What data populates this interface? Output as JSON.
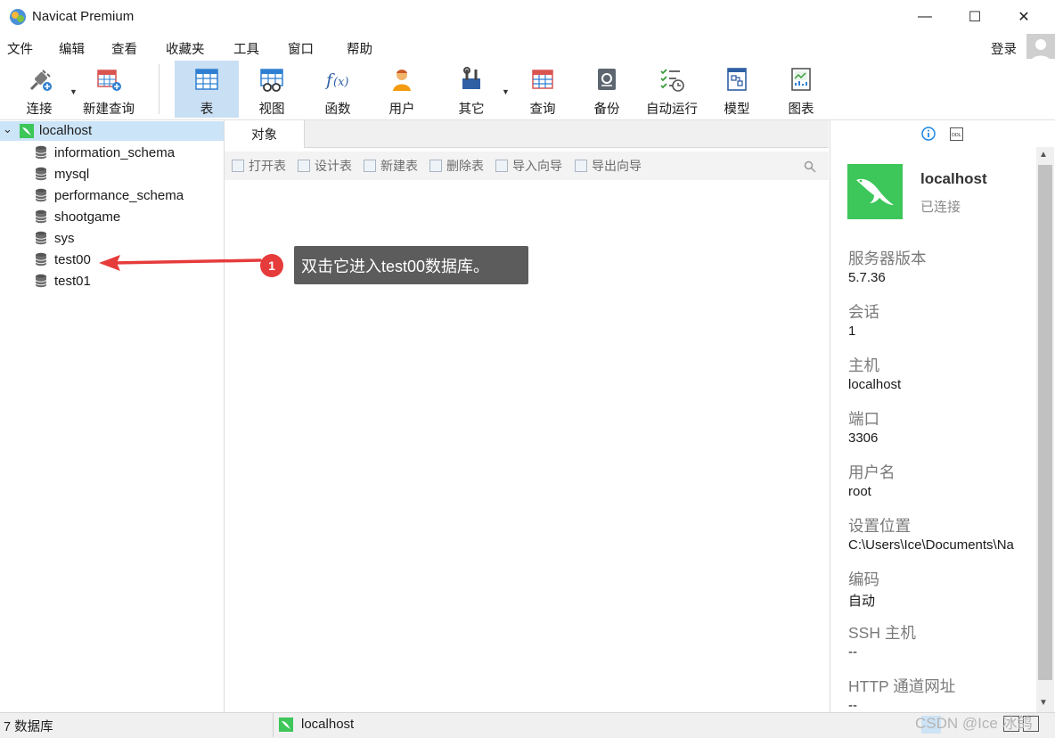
{
  "window": {
    "title": "Navicat Premium"
  },
  "menu": [
    "文件",
    "编辑",
    "查看",
    "收藏夹",
    "工具",
    "窗口",
    "帮助"
  ],
  "account": {
    "login_label": "登录"
  },
  "toolbar": {
    "connect": "连接",
    "new_query": "新建查询",
    "table": "表",
    "view": "视图",
    "function": "函数",
    "user": "用户",
    "other": "其它",
    "query": "查询",
    "backup": "备份",
    "automation": "自动运行",
    "model": "模型",
    "chart": "图表"
  },
  "tree": {
    "root": "localhost",
    "databases": [
      "information_schema",
      "mysql",
      "performance_schema",
      "shootgame",
      "sys",
      "test00",
      "test01"
    ]
  },
  "tabs": {
    "objects": "对象"
  },
  "object_actions": [
    "打开表",
    "设计表",
    "新建表",
    "删除表",
    "导入向导",
    "导出向导"
  ],
  "annotation": {
    "step": "1",
    "text": "双击它进入test00数据库。"
  },
  "info": {
    "name": "localhost",
    "status": "已连接",
    "fields": [
      {
        "label": "服务器版本",
        "value": "5.7.36"
      },
      {
        "label": "会话",
        "value": "1"
      },
      {
        "label": "主机",
        "value": "localhost"
      },
      {
        "label": "端口",
        "value": "3306"
      },
      {
        "label": "用户名",
        "value": "root"
      },
      {
        "label": "设置位置",
        "value": "C:\\Users\\Ice\\Documents\\Na"
      },
      {
        "label": "编码",
        "value": "自动"
      },
      {
        "label": "SSH 主机",
        "value": "--"
      },
      {
        "label": "HTTP 通道网址",
        "value": "--"
      }
    ]
  },
  "status": {
    "count": "7 数据库",
    "connection": "localhost"
  },
  "watermark": "CSDN @Ice 冰鸽",
  "colors": {
    "selection": "#cce4f7",
    "mysql_green": "#3dc65a",
    "annotation_red": "#e63b3b",
    "hint_bg": "#5c5c5c"
  }
}
